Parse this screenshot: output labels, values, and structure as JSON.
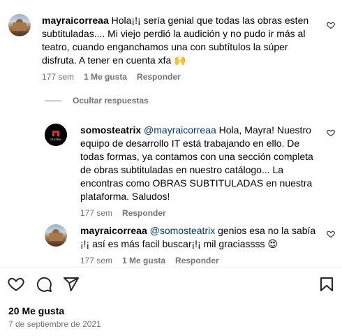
{
  "comments": [
    {
      "username": "mayraicorreaa",
      "text": "Hola¡!¡ sería genial que todas las obras esten subtituladas.... Mi viejo perdió la audición y no pudo ir más al teatro, cuando enganchamos una con subtítulos la súper disfruta. A tener en cuenta xfa 🙌",
      "time": "177 sem",
      "likes": "1 Me gusta",
      "reply": "Responder"
    }
  ],
  "hide_replies": "Ocultar respuestas",
  "replies": [
    {
      "username": "somosteatrix",
      "mention": "@mayraicorreaa",
      "text": "Hola, Mayra! Nuestro equipo de desarrollo IT está trabajando en ello. De todas formas, ya contamos con una sección completa de obras subtituladas en nuestro catálogo... La encontras como OBRAS SUBTITULADAS en nuestra plataforma. Saludos!",
      "time": "177 sem",
      "reply": "Responder",
      "avatar_label": "TEATRIX"
    },
    {
      "username": "mayraicorreaa",
      "mention": "@somosteatrix",
      "text": "genios esa no la sabía ¡!¡ así es más facil buscar¡!¡ mil graciassss 😍",
      "time": "177 sem",
      "likes": "1 Me gusta",
      "reply": "Responder"
    }
  ],
  "actions": {
    "like_icon": "heart-icon",
    "comment_icon": "comment-icon",
    "share_icon": "share-icon",
    "save_icon": "bookmark-icon"
  },
  "post": {
    "likes": "20 Me gusta",
    "date": "7 de septiembre de 2021"
  }
}
